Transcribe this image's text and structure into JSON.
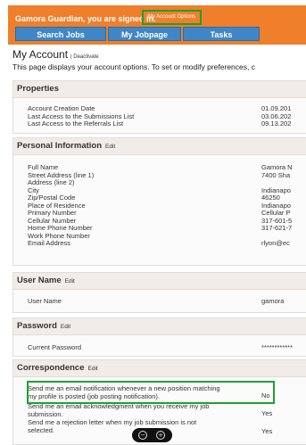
{
  "header": {
    "signed_in": "Gamora Guardian, you are signed in.",
    "account_options": "My Account Options",
    "nav": [
      "Search Jobs",
      "My Jobpage",
      "Tasks"
    ]
  },
  "page": {
    "title": "My Account",
    "deactivate": "| Deactivate",
    "description": "This page displays your account options. To set or modify preferences, c"
  },
  "properties": {
    "title": "Properties",
    "rows": [
      {
        "label": "Account Creation Date",
        "value": "01.09.201"
      },
      {
        "label": "Last Access to the Submissions List",
        "value": "03.06.202"
      },
      {
        "label": "Last Access to the Referrals List",
        "value": "09.13.202"
      }
    ]
  },
  "personal": {
    "title": "Personal Information",
    "edit": "Edit",
    "rows": [
      {
        "label": "Full Name",
        "value": "Gamora N"
      },
      {
        "label": "Street Address (line 1)",
        "value": "7400 Sha"
      },
      {
        "label": "Address (line 2)",
        "value": ""
      },
      {
        "label": "City",
        "value": "Indianapo"
      },
      {
        "label": "Zip/Postal Code",
        "value": "46250"
      },
      {
        "label": "Place of Residence",
        "value": "Indianapo"
      },
      {
        "label": "Primary Number",
        "value": "Cellular P"
      },
      {
        "label": "Cellular Number",
        "value": "317-601-5"
      },
      {
        "label": "Home Phone Number",
        "value": "317-621-7"
      },
      {
        "label": "Work Phone Number",
        "value": ""
      },
      {
        "label": "Email Address",
        "value": "rlyon@ec"
      }
    ]
  },
  "username": {
    "title": "User Name",
    "edit": "Edit",
    "label": "User Name",
    "value": "gamora"
  },
  "password": {
    "title": "Password",
    "edit": "Edit",
    "label": "Current Password",
    "value": "************"
  },
  "correspondence": {
    "title": "Correspondence",
    "edit": "Edit",
    "rows": [
      {
        "line1": "Send me an email notification whenever a new position matching",
        "line2": "my profile is posted (job posting notification).",
        "value": "No"
      },
      {
        "line1": "Send me an email acknowledgment when you receive my job",
        "line2": "submission.",
        "value": "Yes"
      },
      {
        "line1": "Send me a rejection letter when my job submission is not",
        "line2": "selected.",
        "value": "Yes"
      }
    ]
  },
  "zoom": {
    "out": "−",
    "in": "+"
  },
  "colors": {
    "header": "#ef7f2a",
    "nav": "#3f86c6",
    "highlight": "#1ea12f",
    "panel_head": "#f1ece8"
  }
}
